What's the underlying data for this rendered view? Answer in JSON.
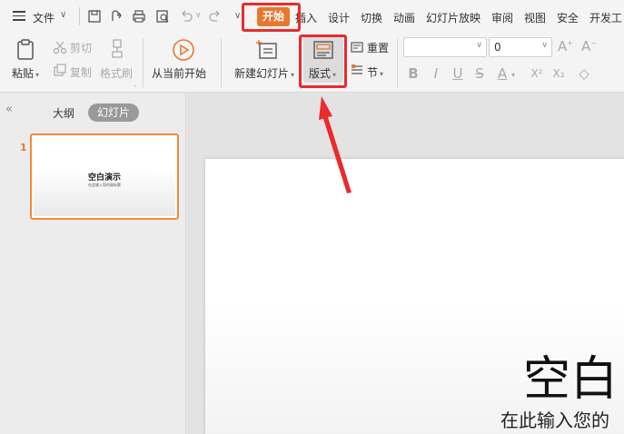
{
  "menubar": {
    "file": "文件",
    "tabs": [
      "开始",
      "插入",
      "设计",
      "切换",
      "动画",
      "幻灯片放映",
      "审阅",
      "视图",
      "安全",
      "开发工"
    ]
  },
  "ribbon": {
    "paste": "粘贴",
    "cut": "剪切",
    "copy": "复制",
    "format_painter": "格式刷",
    "play_from_current": "从当前开始",
    "new_slide": "新建幻灯片",
    "layout": "版式",
    "reset": "重置",
    "section": "节",
    "font_name": "",
    "font_size": "0",
    "format_buttons": [
      "B",
      "I",
      "U",
      "S",
      "A",
      "X²",
      "X₂",
      "◇"
    ]
  },
  "leftpanel": {
    "outline_tab": "大纲",
    "slides_tab": "幻灯片",
    "slide_number": "1",
    "thumb_title": "空白演示",
    "thumb_subtitle": "在此输入您的副标题"
  },
  "slide": {
    "title": "空白",
    "subtitle": "在此输入您的"
  },
  "colors": {
    "accent": "#e8772e",
    "annotation_red": "#ea2b2b"
  }
}
